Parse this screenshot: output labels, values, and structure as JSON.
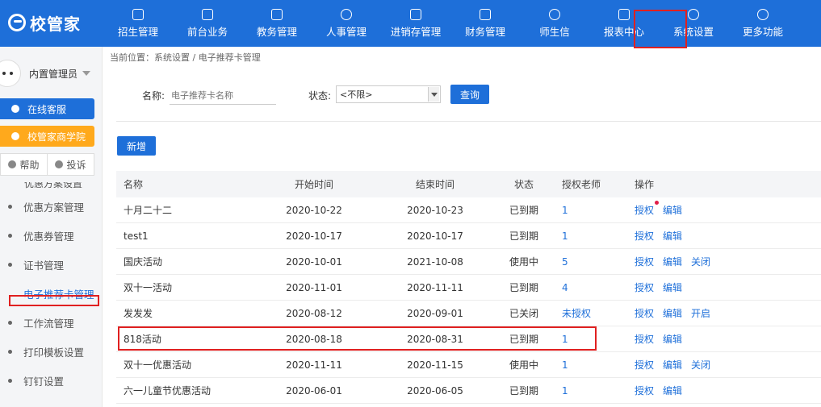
{
  "app": {
    "logo_text": "校管家"
  },
  "nav": [
    {
      "label": "招生管理",
      "icon": "user-plus-icon"
    },
    {
      "label": "前台业务",
      "icon": "monitor-icon"
    },
    {
      "label": "教务管理",
      "icon": "book-icon"
    },
    {
      "label": "人事管理",
      "icon": "person-icon"
    },
    {
      "label": "进销存管理",
      "icon": "box-arrow-icon"
    },
    {
      "label": "财务管理",
      "icon": "money-house-icon"
    },
    {
      "label": "师生信",
      "icon": "chat-bubble-icon"
    },
    {
      "label": "报表中心",
      "icon": "report-icon"
    },
    {
      "label": "系统设置",
      "icon": "settings-icon",
      "active": true
    },
    {
      "label": "更多功能",
      "icon": "more-icon"
    }
  ],
  "sidebar": {
    "username": "内置管理员",
    "service_label": "在线客服",
    "academy_label": "校管家商学院",
    "help_label": "帮助",
    "complaint_label": "投诉",
    "cut_item": "优惠方案设置",
    "items": [
      {
        "label": "优惠方案管理"
      },
      {
        "label": "优惠券管理"
      },
      {
        "label": "证书管理"
      },
      {
        "label": "电子推荐卡管理",
        "active": true
      },
      {
        "label": "工作流管理"
      },
      {
        "label": "打印模板设置"
      },
      {
        "label": "钉钉设置"
      }
    ]
  },
  "breadcrumb": "当前位置：系统设置 / 电子推荐卡管理",
  "filter": {
    "name_label": "名称:",
    "name_placeholder": "电子推荐卡名称",
    "status_label": "状态:",
    "status_value": "<不限>",
    "query_label": "查询"
  },
  "add_label": "新增",
  "table": {
    "headers": {
      "name": "名称",
      "start": "开始时间",
      "end": "结束时间",
      "status": "状态",
      "teachers": "授权老师",
      "ops": "操作"
    },
    "rows": [
      {
        "name": "十月二十二",
        "start": "2020-10-22",
        "end": "2020-10-23",
        "status": "已到期",
        "teachers": "1",
        "ops": [
          "授权",
          "编辑"
        ]
      },
      {
        "name": "test1",
        "start": "2020-10-17",
        "end": "2020-10-17",
        "status": "已到期",
        "teachers": "1",
        "ops": [
          "授权",
          "编辑"
        ]
      },
      {
        "name": "国庆活动",
        "start": "2020-10-01",
        "end": "2021-10-08",
        "status": "使用中",
        "teachers": "5",
        "ops": [
          "授权",
          "编辑",
          "关闭"
        ]
      },
      {
        "name": "双十一活动",
        "start": "2020-11-01",
        "end": "2020-11-11",
        "status": "已到期",
        "teachers": "4",
        "ops": [
          "授权",
          "编辑"
        ]
      },
      {
        "name": "发发发",
        "start": "2020-08-12",
        "end": "2020-09-01",
        "status": "已关闭",
        "teachers": "未授权",
        "ops": [
          "授权",
          "编辑",
          "开启"
        ]
      },
      {
        "name": "818活动",
        "start": "2020-08-18",
        "end": "2020-08-31",
        "status": "已到期",
        "teachers": "1",
        "ops": [
          "授权",
          "编辑"
        ]
      },
      {
        "name": "双十一优惠活动",
        "start": "2020-11-11",
        "end": "2020-11-15",
        "status": "使用中",
        "teachers": "1",
        "ops": [
          "授权",
          "编辑",
          "关闭"
        ]
      },
      {
        "name": "六一儿童节优惠活动",
        "start": "2020-06-01",
        "end": "2020-06-05",
        "status": "已到期",
        "teachers": "1",
        "ops": [
          "授权",
          "编辑"
        ]
      }
    ]
  },
  "colors": {
    "primary": "#1e6fd9",
    "accent": "#ffa91c",
    "annotation": "#e02020"
  }
}
